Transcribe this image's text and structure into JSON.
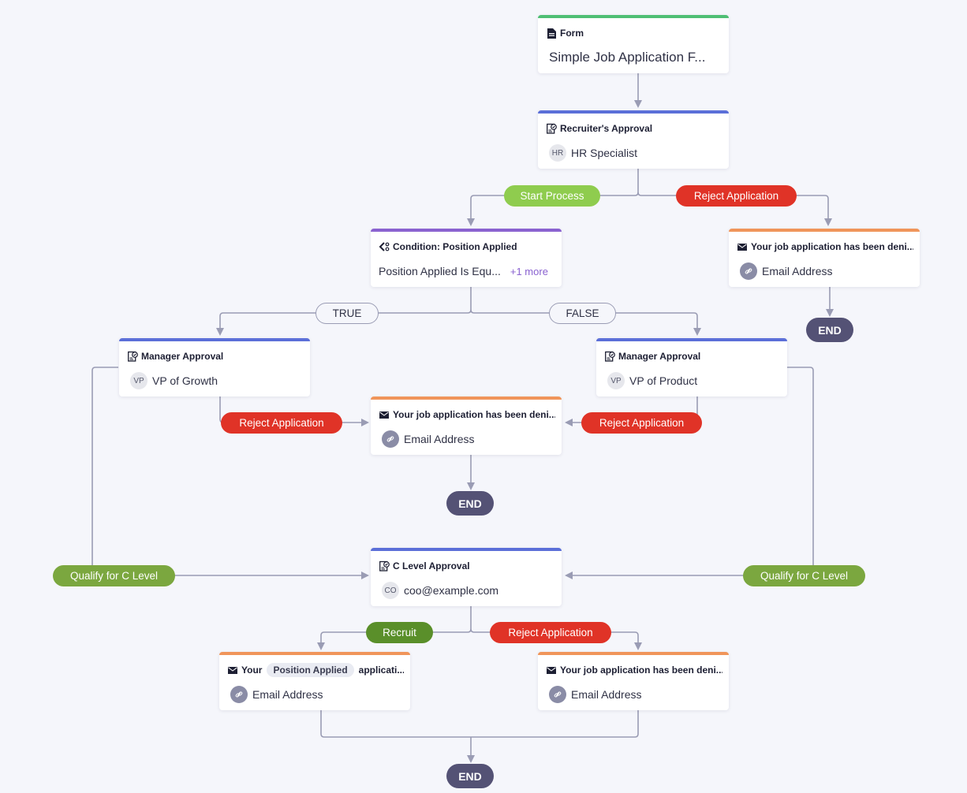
{
  "colors": {
    "form": "#4fbf74",
    "approval": "#5b6fd8",
    "condition": "#8a62d0",
    "email": "#f0955a",
    "wire": "#9a9cb4",
    "end": "#545275",
    "start_process": "#8fcc4e",
    "reject": "#e03327",
    "qualify": "#7ba73f",
    "recruit": "#5a8f2a"
  },
  "nodes": {
    "form": {
      "type_label": "Form",
      "body": "Simple Job Application F..."
    },
    "recruiter_approval": {
      "title": "Recruiter's  Approval",
      "avatar": "HR",
      "assignee": "HR Specialist"
    },
    "condition": {
      "title": "Condition: Position Applied",
      "body": "Position Applied Is Equ...",
      "more": "+1 more"
    },
    "email_denied_top": {
      "title": "Your job application has been deni...",
      "recipient": "Email Address"
    },
    "end_top": {
      "label": "END"
    },
    "manager_approval_left": {
      "title": "Manager Approval",
      "avatar": "VP",
      "assignee": "VP of Growth"
    },
    "manager_approval_right": {
      "title": "Manager Approval",
      "avatar": "VP",
      "assignee": "VP of Product"
    },
    "email_denied_middle": {
      "title": "Your job application has been deni...",
      "recipient": "Email Address"
    },
    "end_middle": {
      "label": "END"
    },
    "c_level_approval": {
      "title": "C Level Approval",
      "avatar": "CO",
      "assignee": "coo@example.com"
    },
    "email_position": {
      "title_prefix": "Your",
      "title_chip": "Position Applied",
      "title_suffix": "applicati...",
      "recipient": "Email Address"
    },
    "email_denied_bottom": {
      "title": "Your job application has been deni...",
      "recipient": "Email Address"
    },
    "end_bottom": {
      "label": "END"
    }
  },
  "edges": {
    "start_process": "Start Process",
    "reject_top": "Reject Application",
    "true_branch": "TRUE",
    "false_branch": "FALSE",
    "reject_left": "Reject Application",
    "reject_right": "Reject Application",
    "qualify_left": "Qualify for C Level",
    "qualify_right": "Qualify for C Level",
    "recruit": "Recruit",
    "reject_bottom": "Reject Application"
  }
}
